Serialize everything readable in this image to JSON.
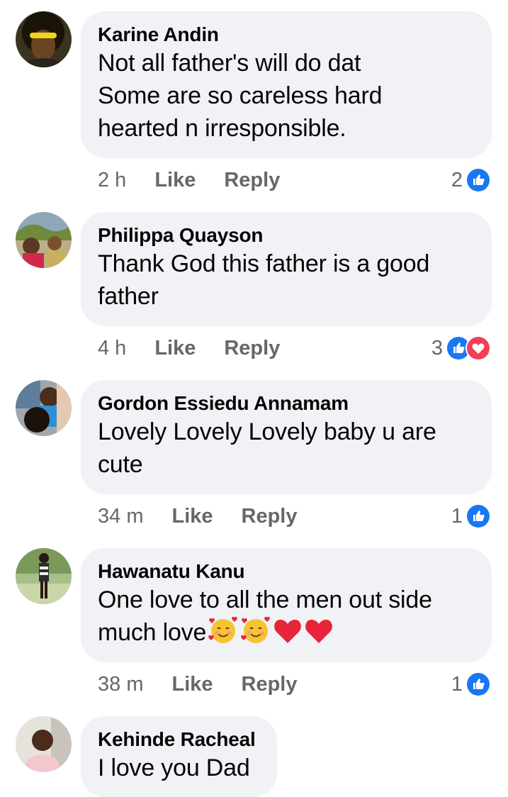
{
  "comments": [
    {
      "author": "Karine Andin",
      "text": "Not all father's will do dat\nSome are so careless hard\nhearted n irresponsible.",
      "time": "2 h",
      "like_label": "Like",
      "reply_label": "Reply",
      "reaction_count": "2",
      "reactions": [
        "like-icon"
      ]
    },
    {
      "author": "Philippa Quayson",
      "text": "Thank God this father is a good\nfather",
      "time": "4 h",
      "like_label": "Like",
      "reply_label": "Reply",
      "reaction_count": "3",
      "reactions": [
        "like-icon",
        "love-icon"
      ]
    },
    {
      "author": "Gordon Essiedu Annamam",
      "text": "Lovely Lovely Lovely baby u are\ncute",
      "time": "34 m",
      "like_label": "Like",
      "reply_label": "Reply",
      "reaction_count": "1",
      "reactions": [
        "like-icon"
      ]
    },
    {
      "author": "Hawanatu Kanu",
      "text": "One love to all the men out side\nmuch love",
      "emoji": [
        "smiling-face-with-hearts-icon",
        "smiling-face-with-hearts-icon",
        "red-heart-icon",
        "red-heart-icon"
      ],
      "time": "38 m",
      "like_label": "Like",
      "reply_label": "Reply",
      "reaction_count": "1",
      "reactions": [
        "like-icon"
      ]
    },
    {
      "author": "Kehinde Racheal",
      "text": "I love you Dad"
    }
  ],
  "colors": {
    "bubble": "#f0f2f5",
    "meta_text": "#65676b",
    "like_blue": "#1877f2",
    "love_red": "#f33e58"
  }
}
